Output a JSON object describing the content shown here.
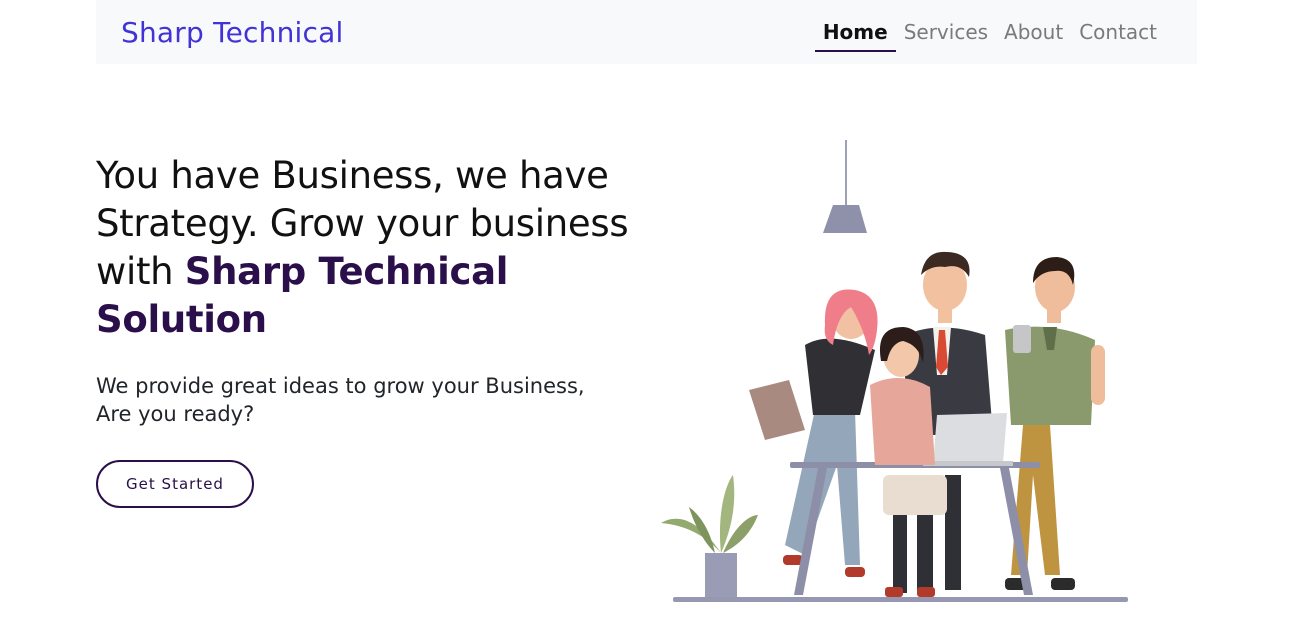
{
  "navbar": {
    "brand": "Sharp Technical",
    "links": [
      {
        "label": "Home",
        "active": true
      },
      {
        "label": "Services",
        "active": false
      },
      {
        "label": "About",
        "active": false
      },
      {
        "label": "Contact",
        "active": false
      }
    ]
  },
  "hero": {
    "headline_plain": "You have Business, we have Strategy. Grow your business with ",
    "headline_brand": "Sharp Technical Solution",
    "subheadline": "We provide great ideas to grow your Business, Are you ready?",
    "cta_label": "Get Started"
  },
  "colors": {
    "brand": "#4233d6",
    "accent_dark": "#2a0f4a",
    "navbar_bg": "#f8f9fa"
  },
  "illustration": {
    "description_icon": "team-working-illustration"
  }
}
